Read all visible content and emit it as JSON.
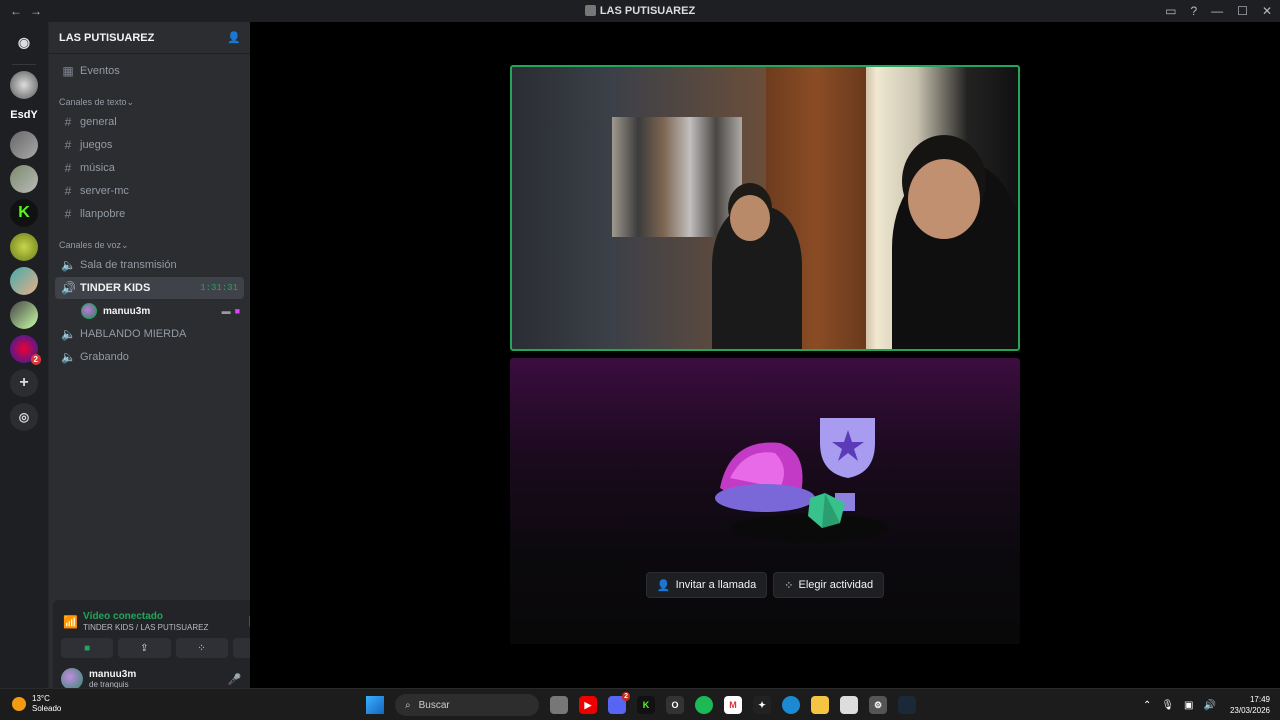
{
  "window": {
    "title": "LAS PUTISUAREZ",
    "back": "←",
    "forward": "→"
  },
  "guilds": [
    {
      "kind": "dm",
      "label": ""
    },
    {
      "kind": "server",
      "label": ""
    },
    {
      "kind": "text",
      "label": "EsdY"
    },
    {
      "kind": "server",
      "label": ""
    },
    {
      "kind": "server",
      "label": ""
    },
    {
      "kind": "server",
      "label": "K"
    },
    {
      "kind": "server",
      "label": ""
    },
    {
      "kind": "server",
      "label": ""
    },
    {
      "kind": "server",
      "label": ""
    },
    {
      "kind": "server",
      "label": "",
      "badge": "2"
    }
  ],
  "server": {
    "name": "LAS PUTISUAREZ",
    "events_label": "Eventos",
    "text_category": "Canales de texto",
    "text_channels": [
      "general",
      "juegos",
      "música",
      "server-mc",
      "llanpobre"
    ],
    "voice_category": "Canales de voz",
    "voice_channels": {
      "c1": "Sala de transmisión",
      "c2": "TINDER KIDS",
      "c2_timer": "1:31:31",
      "c2_user": "manuu3m",
      "c3": "HABLANDO MIERDA",
      "c4": "Grabando"
    }
  },
  "voice_panel": {
    "status": "Vídeo conectado",
    "location": "TINDER KIDS / LAS PUTISUAREZ",
    "username": "manuu3m",
    "user_status": "de tranquis"
  },
  "activity": {
    "invite_label": "Invitar a llamada",
    "choose_label": "Elegir actividad"
  },
  "taskbar": {
    "temp": "13°C",
    "weather": "Soleado",
    "search_placeholder": "Buscar",
    "time": "17:49",
    "date": "23/03/2026",
    "discord_badge": "2"
  },
  "colors": {
    "accent_green": "#23a55a",
    "channel_bg": "#2b2d31",
    "guild_bg": "#1e1f22"
  }
}
